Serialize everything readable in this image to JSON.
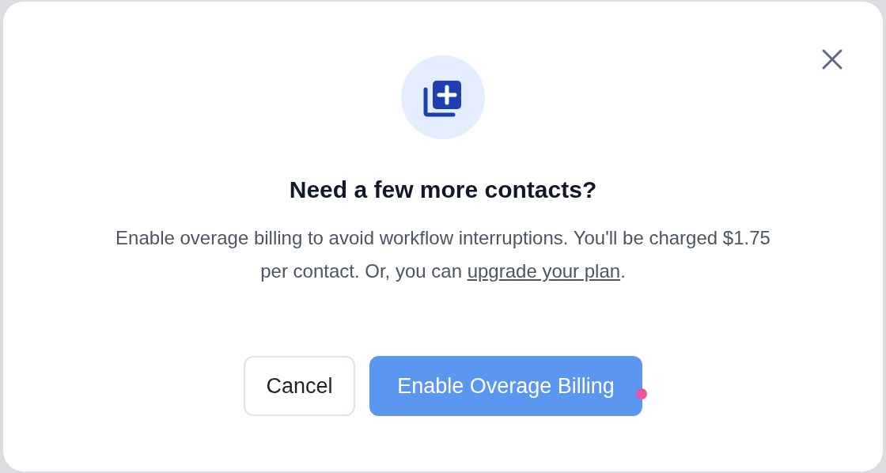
{
  "dialog": {
    "title": "Need a few more contacts?",
    "message": {
      "before": "Enable overage billing to avoid workflow interruptions. You'll be charged $1.75 per contact. Or, you can ",
      "link": "upgrade your plan",
      "after": "."
    },
    "buttons": [
      {
        "label": "Cancel",
        "kind": "secondary"
      },
      {
        "label": "Enable Overage Billing",
        "kind": "primary"
      }
    ]
  }
}
